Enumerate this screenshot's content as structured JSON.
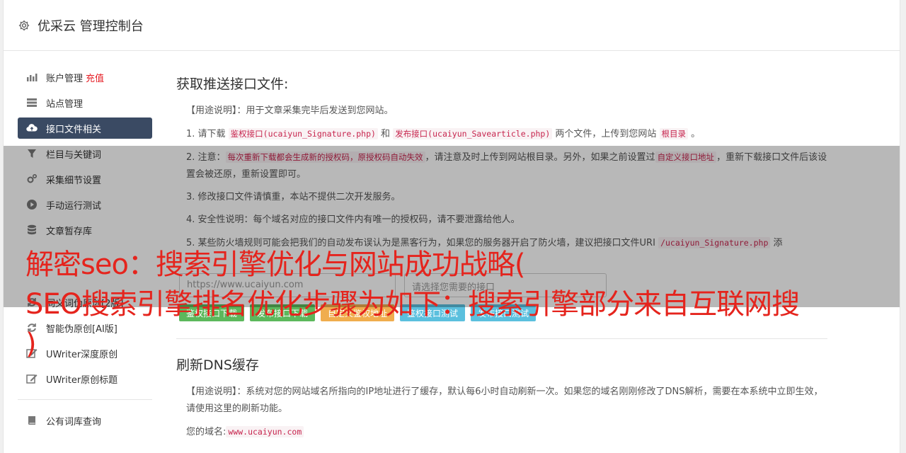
{
  "header": {
    "title": "优采云 管理控制台",
    "icon": "gear-icon"
  },
  "sidebar": {
    "items": [
      {
        "label": "账户管理",
        "extra": "充值",
        "icon": "bar-chart-icon"
      },
      {
        "label": "站点管理",
        "icon": "server-icon"
      },
      {
        "label": "接口文件相关",
        "icon": "cloud-upload-icon",
        "active": true
      },
      {
        "label": "栏目与关键词",
        "icon": "filter-icon"
      },
      {
        "label": "采集细节设置",
        "icon": "cogs-icon"
      },
      {
        "label": "手动运行测试",
        "icon": "play-icon"
      },
      {
        "label": "文章暂存库",
        "icon": "database-icon"
      },
      {
        "label": "同义词伪原创[2版]",
        "icon": "refresh-icon"
      },
      {
        "label": "智能伪原创[AI版]",
        "icon": "refresh-icon"
      },
      {
        "label": "UWriter深度原创",
        "icon": "edit-icon"
      },
      {
        "label": "UWriter原创标题",
        "icon": "edit-icon"
      },
      {
        "label": "公有词库查询",
        "icon": "book-icon"
      }
    ]
  },
  "section1": {
    "title": "获取推送接口文件:",
    "usage_label": "【用途说明】",
    "usage_text": "：用于文章采集完毕后发送到您网站。",
    "p1_a": "1. 请下载 ",
    "p1_code1": "鉴权接口(ucaiyun_Signature.php)",
    "p1_b": " 和 ",
    "p1_code2": "发布接口(ucaiyun_Savearticle.php)",
    "p1_c": " 两个文件，上传到您网站 ",
    "p1_code3": "根目录",
    "p1_d": " 。",
    "p2_a": "2. 注意：",
    "p2_code1": "每次重新下载都会生成新的授权码，原授权码自动失效",
    "p2_b": "，请注意及时上传到网站根目录。另外，如果之前设置过",
    "p2_code2": "自定义接口地址",
    "p2_c": "，重新下载接口文件后该设置会被还原，重新设置即可。",
    "p3": "3. 修改接口文件请慎重，本站不提供二次开发服务。",
    "p4": "4. 安全性说明：每个域名对应的接口文件内有唯一的授权码，请不要泄露给他人。",
    "p5_a": "5. 某些防火墙规则可能会把我们的自动发布误认为是黑客行为，如果您的服务器开启了防火墙，建议把接口文件URI ",
    "p5_code": "/ucaiyun_Signature.php",
    "p5_b": " 添",
    "url_value": "https://www.ucaiyun.com",
    "select_placeholder": "请选择您需要的接口",
    "buttons": [
      "鉴权接口下载",
      "发布接口下载",
      "自定义鉴权地址",
      "鉴权接口测试",
      "发布接口测试"
    ]
  },
  "section2": {
    "title": "刷新DNS缓存",
    "usage_label": "【用途说明】",
    "usage_text": "：系统对您的网站域名所指向的IP地址进行了缓存，默认每6小时自动刷新一次。如果您的域名刚刚修改了DNS解析，需要在本系统中立即生效，请使用这里的刷新功能。",
    "domain_label": "您的域名:",
    "domain_value": "www.ucaiyun.com"
  },
  "overlay_text": {
    "line1": "解密seo：搜索引擎优化与网站成功战略(",
    "line2": "SEO搜索引擎排名优化步骤为如下：搜索引擎部分来自互联网搜",
    "line3": ")"
  }
}
